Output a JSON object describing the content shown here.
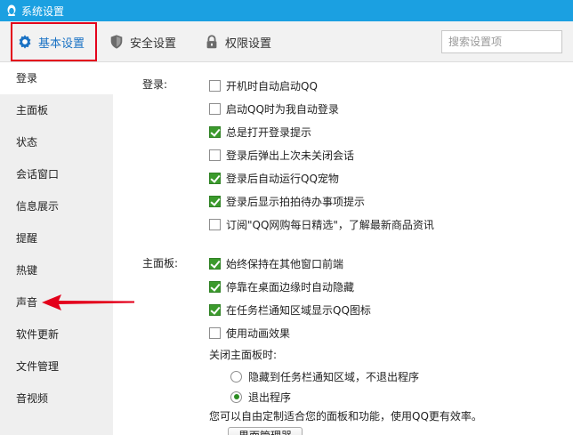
{
  "window": {
    "title": "系统设置"
  },
  "tabs": [
    {
      "label": "基本设置",
      "icon": "gear-icon"
    },
    {
      "label": "安全设置",
      "icon": "shield-icon"
    },
    {
      "label": "权限设置",
      "icon": "lock-icon"
    }
  ],
  "search": {
    "placeholder": "搜索设置项"
  },
  "sidebar": {
    "items": [
      {
        "label": "登录"
      },
      {
        "label": "主面板"
      },
      {
        "label": "状态"
      },
      {
        "label": "会话窗口"
      },
      {
        "label": "信息展示"
      },
      {
        "label": "提醒"
      },
      {
        "label": "热键"
      },
      {
        "label": "声音"
      },
      {
        "label": "软件更新"
      },
      {
        "label": "文件管理"
      },
      {
        "label": "音视频"
      }
    ]
  },
  "login_section": {
    "label": "登录:",
    "options": [
      {
        "label": "开机时自动启动QQ",
        "checked": false
      },
      {
        "label": "启动QQ时为我自动登录",
        "checked": false
      },
      {
        "label": "总是打开登录提示",
        "checked": true
      },
      {
        "label": "登录后弹出上次未关闭会话",
        "checked": false
      },
      {
        "label": "登录后自动运行QQ宠物",
        "checked": true
      },
      {
        "label": "登录后显示拍拍待办事项提示",
        "checked": true
      },
      {
        "label": "订阅\"QQ网购每日精选\"，了解最新商品资讯",
        "checked": false
      }
    ]
  },
  "panel_section": {
    "label": "主面板:",
    "options": [
      {
        "label": "始终保持在其他窗口前端",
        "checked": true
      },
      {
        "label": "停靠在桌面边缘时自动隐藏",
        "checked": true
      },
      {
        "label": "在任务栏通知区域显示QQ图标",
        "checked": true
      },
      {
        "label": "使用动画效果",
        "checked": false
      }
    ],
    "close_label": "关闭主面板时:",
    "close_options": [
      {
        "label": "隐藏到任务栏通知区域，不退出程序",
        "selected": false
      },
      {
        "label": "退出程序",
        "selected": true
      }
    ],
    "hint": "您可以自由定制适合您的面板和功能，使用QQ更有效率。",
    "manager_button": "界面管理器"
  },
  "colors": {
    "titlebar": "#1ba0e1",
    "highlight_border": "#e3001b",
    "arrow": "#e3001b",
    "check": "#3b9a2c"
  }
}
